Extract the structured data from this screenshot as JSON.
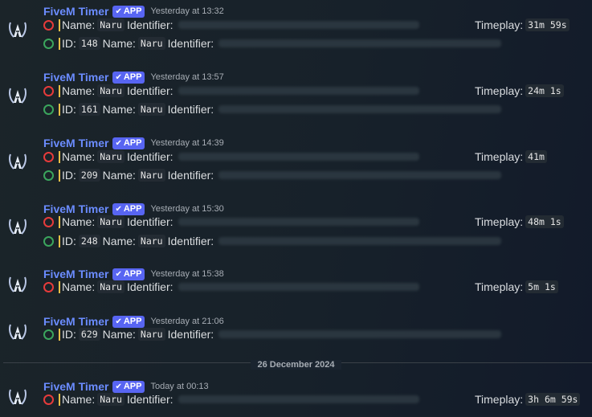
{
  "messages": [
    {
      "author": "FiveM Timer",
      "badge": "APP",
      "timestamp": "Yesterday at 13:32",
      "lines": [
        {
          "status": "red",
          "field": "Name:",
          "code": "Naru",
          "id_label": "Identifier:",
          "tp_label": "Timeplay:",
          "timeplay": "31m 59s"
        },
        {
          "status": "green",
          "field": "ID:",
          "code": "148",
          "name_label": "Name:",
          "code2": "Naru",
          "id_label": "Identifier:"
        }
      ]
    },
    {
      "author": "FiveM Timer",
      "badge": "APP",
      "timestamp": "Yesterday at 13:57",
      "lines": [
        {
          "status": "red",
          "field": "Name:",
          "code": "Naru",
          "id_label": "Identifier:",
          "tp_label": "Timeplay:",
          "timeplay": "24m 1s"
        },
        {
          "status": "green",
          "field": "ID:",
          "code": "161",
          "name_label": "Name:",
          "code2": "Naru",
          "id_label": "Identifier:"
        }
      ]
    },
    {
      "author": "FiveM Timer",
      "badge": "APP",
      "timestamp": "Yesterday at 14:39",
      "lines": [
        {
          "status": "red",
          "field": "Name:",
          "code": "Naru",
          "id_label": "Identifier:",
          "tp_label": "Timeplay:",
          "timeplay": "41m"
        },
        {
          "status": "green",
          "field": "ID:",
          "code": "209",
          "name_label": "Name:",
          "code2": "Naru",
          "id_label": "Identifier:"
        }
      ]
    },
    {
      "author": "FiveM Timer",
      "badge": "APP",
      "timestamp": "Yesterday at 15:30",
      "lines": [
        {
          "status": "red",
          "field": "Name:",
          "code": "Naru",
          "id_label": "Identifier:",
          "tp_label": "Timeplay:",
          "timeplay": "48m 1s"
        },
        {
          "status": "green",
          "field": "ID:",
          "code": "248",
          "name_label": "Name:",
          "code2": "Naru",
          "id_label": "Identifier:"
        }
      ]
    },
    {
      "author": "FiveM Timer",
      "badge": "APP",
      "timestamp": "Yesterday at 15:38",
      "lines": [
        {
          "status": "red",
          "field": "Name:",
          "code": "Naru",
          "id_label": "Identifier:",
          "tp_label": "Timeplay:",
          "timeplay": "5m 1s"
        }
      ]
    },
    {
      "author": "FiveM Timer",
      "badge": "APP",
      "timestamp": "Yesterday at 21:06",
      "lines": [
        {
          "status": "green",
          "field": "ID:",
          "code": "629",
          "name_label": "Name:",
          "code2": "Naru",
          "id_label": "Identifier:"
        }
      ]
    }
  ],
  "divider": {
    "label": "26 December 2024"
  },
  "last_message": {
    "author": "FiveM Timer",
    "badge": "APP",
    "timestamp": "Today at 00:13",
    "lines": [
      {
        "status": "red",
        "field": "Name:",
        "code": "Naru",
        "id_label": "Identifier:",
        "tp_label": "Timeplay:",
        "timeplay": "3h 6m 59s"
      }
    ]
  },
  "colors": {
    "author": "#6b8cff",
    "badge": "#5865f2",
    "left_status": "#e63b3b",
    "join_status": "#3ba55d",
    "bar": "#e9c046"
  },
  "icons": {
    "avatar": "fivem-logo-icon",
    "badge_check": "check-icon"
  }
}
